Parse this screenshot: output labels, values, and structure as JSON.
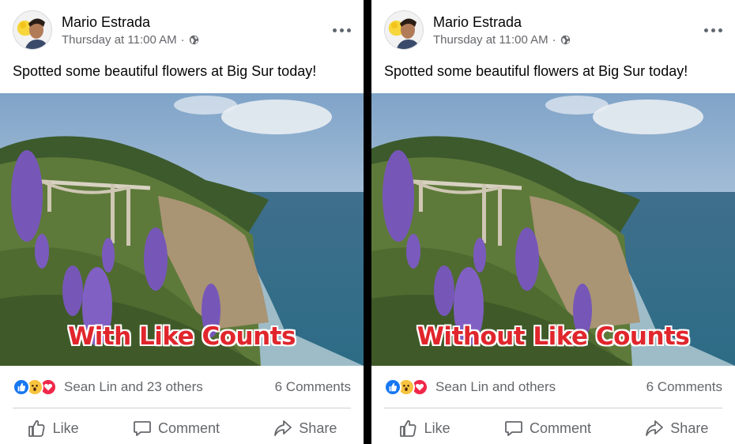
{
  "panels": [
    {
      "author": "Mario Estrada",
      "timestamp": "Thursday at 11:00 AM",
      "separator": "·",
      "post_text": "Spotted some beautiful flowers at Big Sur today!",
      "overlay_label": "With Like Counts",
      "reactors": "Sean Lin and 23 others",
      "comments": "6 Comments",
      "actions": {
        "like": "Like",
        "comment": "Comment",
        "share": "Share"
      }
    },
    {
      "author": "Mario Estrada",
      "timestamp": "Thursday at 11:00 AM",
      "separator": "·",
      "post_text": "Spotted some beautiful flowers at Big Sur today!",
      "overlay_label": "Without Like Counts",
      "reactors": "Sean Lin and others",
      "comments": "6 Comments",
      "actions": {
        "like": "Like",
        "comment": "Comment",
        "share": "Share"
      }
    }
  ],
  "icons": {
    "privacy": "globe-icon",
    "menu": "more-options-icon",
    "reactions": [
      "like-reaction-icon",
      "wow-reaction-icon",
      "love-reaction-icon"
    ],
    "actions": [
      "thumbs-up-icon",
      "comment-bubble-icon",
      "share-arrow-icon"
    ]
  },
  "colors": {
    "like": "#1877f2",
    "wow": "#f7c33e",
    "love": "#f0284a",
    "overlay_text": "#e0262c",
    "secondary_text": "#65676b"
  }
}
